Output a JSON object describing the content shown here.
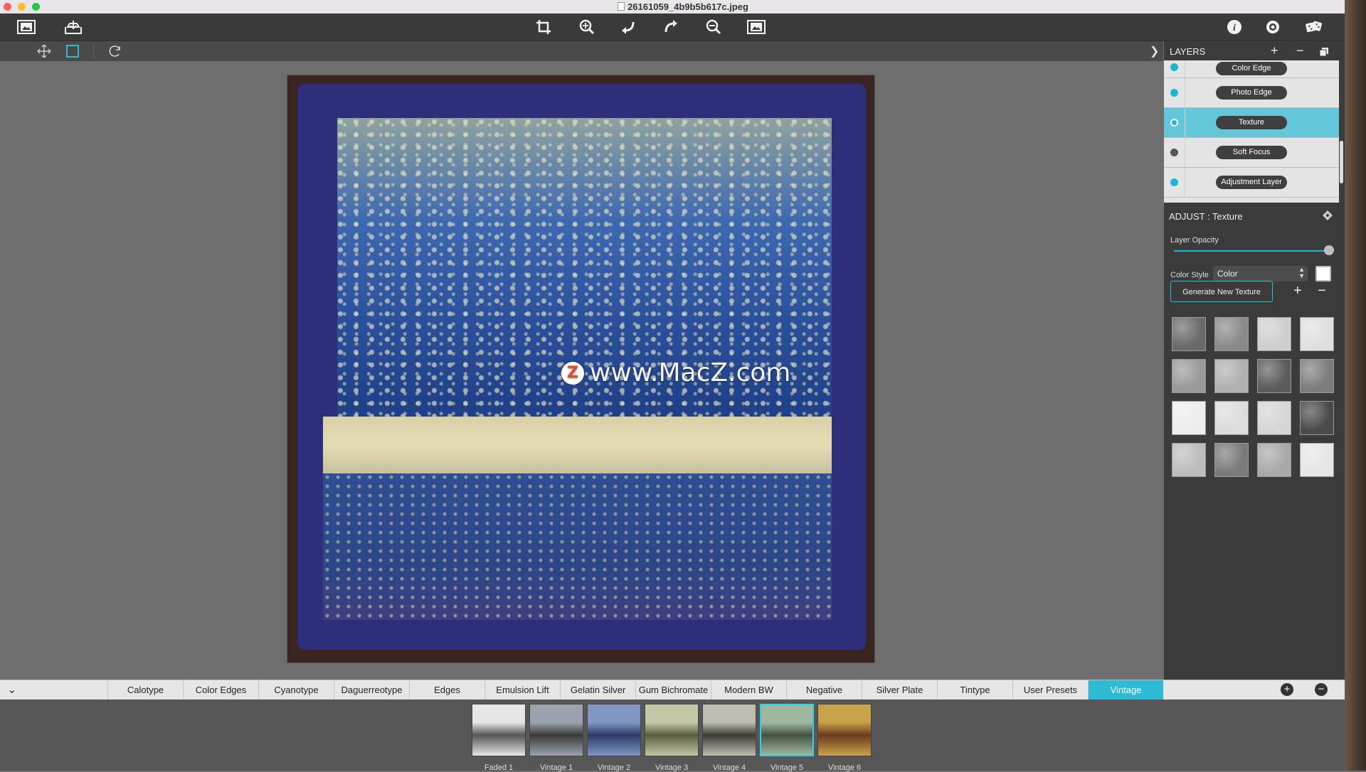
{
  "window": {
    "title": "26161059_4b9b5b617c.jpeg"
  },
  "toolbar": {
    "left_icons": [
      "open-image-icon",
      "export-icon"
    ],
    "center_icons": [
      "crop-icon",
      "zoom-in-icon",
      "undo-icon",
      "redo-icon",
      "zoom-out-icon",
      "fit-image-icon"
    ],
    "right_icons": [
      "info-icon",
      "settings-icon",
      "random-dice-icon"
    ]
  },
  "subtoolbar": {
    "icons": [
      "move-icon",
      "select-rect-icon",
      "rotate-icon"
    ],
    "collapse_icon": "chevron-right-icon"
  },
  "watermark": {
    "text": "www.MacZ.com",
    "logo_letter": "Z"
  },
  "layers": {
    "title": "LAYERS",
    "add": "+",
    "remove": "−",
    "items": [
      {
        "label": "Color Edge",
        "visible": true,
        "selected": false
      },
      {
        "label": "Photo Edge",
        "visible": true,
        "selected": false
      },
      {
        "label": "Texture",
        "visible": true,
        "selected": true
      },
      {
        "label": "Soft Focus",
        "visible": false,
        "selected": false
      },
      {
        "label": "Adjustment Layer",
        "visible": true,
        "selected": false
      }
    ]
  },
  "adjust": {
    "title": "ADJUST : Texture",
    "opacity_label": "Layer Opacity",
    "opacity_value": 1.0,
    "color_style_label": "Color Style",
    "color_style_value": "Color",
    "generate_label": "Generate New Texture",
    "plus": "+",
    "minus": "−"
  },
  "textures": [
    "#6a6a6a",
    "#8a8a8a",
    "#cfcfcf",
    "#e0e0e0",
    "#9a9a9a",
    "#b0b0b0",
    "#5c5c5c",
    "#7d7d7d",
    "#ededed",
    "#dcdcdc",
    "#d6d6d6",
    "#4a4a4a",
    "#bdbdbd",
    "#7a7a7a",
    "#a9a9a9",
    "#e6e6e6"
  ],
  "presets": {
    "tabs": [
      "Calotype",
      "Color Edges",
      "Cyanotype",
      "Daguerreotype",
      "Edges",
      "Emulsion Lift",
      "Gelatin Silver",
      "Gum Bichromate",
      "Modern BW",
      "Negative",
      "Silver Plate",
      "Tintype",
      "User Presets",
      "Vintage"
    ],
    "active": "Vintage",
    "thumbs": [
      {
        "label": "Faded 1",
        "colors": [
          "#e6e6e6",
          "#555555"
        ]
      },
      {
        "label": "Vintage 1",
        "colors": [
          "#9aa3ae",
          "#3a3a3a"
        ]
      },
      {
        "label": "Vintage 2",
        "colors": [
          "#7f96c4",
          "#2d3a66"
        ]
      },
      {
        "label": "Vintage 3",
        "colors": [
          "#c4c8a6",
          "#5b5c3f"
        ]
      },
      {
        "label": "Vintage 4",
        "colors": [
          "#bdbdb0",
          "#3c3c36"
        ]
      },
      {
        "label": "Vintage 5",
        "colors": [
          "#9fb7a0",
          "#44533f"
        ]
      },
      {
        "label": "Vintage 6",
        "colors": [
          "#c9a24a",
          "#6a3b1c"
        ]
      }
    ]
  },
  "colors": {
    "accent": "#2fbad4"
  }
}
